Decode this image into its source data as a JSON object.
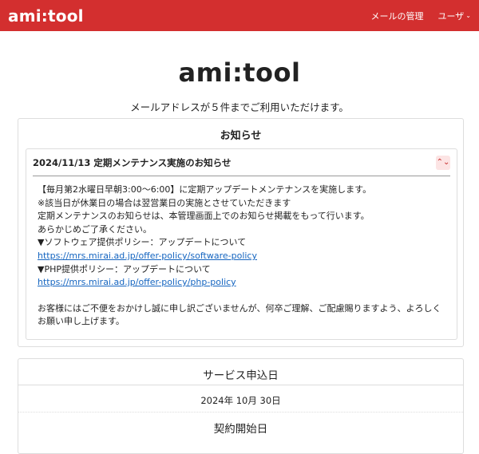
{
  "header": {
    "brand": "ami:tool",
    "nav": [
      {
        "label": "メールの管理"
      },
      {
        "label": "ユーザ",
        "caret": "⌄"
      }
    ]
  },
  "hero": {
    "title": "ami:tool",
    "subtitle": "メールアドレスが５件までご利用いただけます。"
  },
  "notices": {
    "title": "お知らせ",
    "item": {
      "heading": "2024/11/13 定期メンテナンス実施のお知らせ",
      "toggle_icon": "⌃⌄",
      "lines": [
        "【毎月第2水曜日早朝3:00～6:00】に定期アップデートメンテナンスを実施します。",
        "※該当日が休業日の場合は翌営業日の実施とさせていただきます",
        "定期メンテナンスのお知らせは、本管理画面上でのお知らせ掲載をもって行います。",
        "あらかじめご了承ください。",
        "▼ソフトウェア提供ポリシー：アップデートについて"
      ],
      "link1": "https://mrs.mirai.ad.jp/offer-policy/software-policy",
      "line_php": "▼PHP提供ポリシー：アップデートについて",
      "link2": "https://mrs.mirai.ad.jp/offer-policy/php-policy",
      "closing": "お客様にはご不便をおかけし誠に申し訳ございませんが、何卒ご理解、ご配慮賜りますよう、よろしくお願い申し上げます。"
    }
  },
  "service": {
    "apply_label": "サービス申込日",
    "apply_date": "2024年 10月 30日",
    "start_label": "契約開始日"
  }
}
